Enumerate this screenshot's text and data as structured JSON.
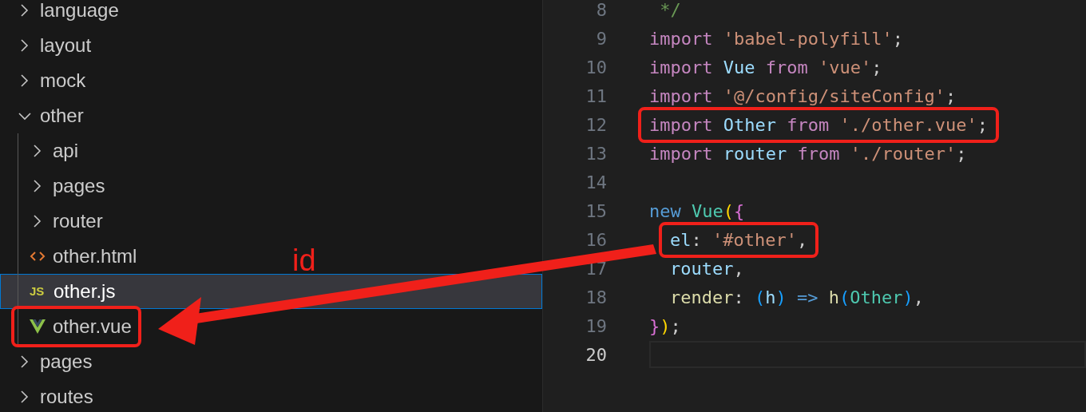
{
  "explorer": {
    "items": [
      {
        "name": "language",
        "kind": "folder",
        "expanded": false,
        "selected": false
      },
      {
        "name": "layout",
        "kind": "folder",
        "expanded": false,
        "selected": false
      },
      {
        "name": "mock",
        "kind": "folder",
        "expanded": false,
        "selected": false
      },
      {
        "name": "other",
        "kind": "folder",
        "expanded": true,
        "selected": false,
        "children": [
          {
            "name": "api",
            "kind": "folder",
            "expanded": false,
            "selected": false
          },
          {
            "name": "pages",
            "kind": "folder",
            "expanded": false,
            "selected": false
          },
          {
            "name": "router",
            "kind": "folder",
            "expanded": false,
            "selected": false
          },
          {
            "name": "other.html",
            "kind": "html",
            "selected": false
          },
          {
            "name": "other.js",
            "kind": "js",
            "badge": "JS",
            "selected": true
          },
          {
            "name": "other.vue",
            "kind": "vue",
            "selected": false,
            "boxed": true
          }
        ]
      },
      {
        "name": "pages",
        "kind": "folder",
        "expanded": false,
        "selected": false
      },
      {
        "name": "routes",
        "kind": "folder",
        "expanded": false,
        "selected": false
      }
    ]
  },
  "editor": {
    "lines": [
      {
        "number": "8",
        "current": false,
        "tokens": [
          {
            "kind": "comment",
            "text": " */"
          }
        ]
      },
      {
        "number": "9",
        "current": false,
        "tokens": [
          {
            "kind": "keyword",
            "text": "import "
          },
          {
            "kind": "string",
            "text": "'babel-polyfill'"
          },
          {
            "kind": "punct",
            "text": ";"
          }
        ]
      },
      {
        "number": "10",
        "current": false,
        "tokens": [
          {
            "kind": "keyword",
            "text": "import "
          },
          {
            "kind": "variable",
            "text": "Vue "
          },
          {
            "kind": "keyword",
            "text": "from "
          },
          {
            "kind": "string",
            "text": "'vue'"
          },
          {
            "kind": "punct",
            "text": ";"
          }
        ]
      },
      {
        "number": "11",
        "current": false,
        "tokens": [
          {
            "kind": "keyword",
            "text": "import "
          },
          {
            "kind": "string",
            "text": "'@/config/siteConfig'"
          },
          {
            "kind": "punct",
            "text": ";"
          }
        ]
      },
      {
        "number": "12",
        "current": false,
        "boxed": true,
        "tokens": [
          {
            "kind": "keyword",
            "text": "import "
          },
          {
            "kind": "variable",
            "text": "Other "
          },
          {
            "kind": "keyword",
            "text": "from "
          },
          {
            "kind": "string",
            "text": "'./other.vue'"
          },
          {
            "kind": "punct",
            "text": ";"
          }
        ]
      },
      {
        "number": "13",
        "current": false,
        "tokens": [
          {
            "kind": "keyword",
            "text": "import "
          },
          {
            "kind": "variable",
            "text": "router "
          },
          {
            "kind": "keyword",
            "text": "from "
          },
          {
            "kind": "string",
            "text": "'./router'"
          },
          {
            "kind": "punct",
            "text": ";"
          }
        ]
      },
      {
        "number": "14",
        "current": false
      },
      {
        "number": "15",
        "current": false,
        "tokens": [
          {
            "kind": "storage",
            "text": "new "
          },
          {
            "kind": "class",
            "text": "Vue"
          },
          {
            "kind": "bracket1",
            "text": "("
          },
          {
            "kind": "bracket2",
            "text": "{"
          }
        ]
      },
      {
        "number": "16",
        "current": false,
        "indented": true,
        "boxed": true,
        "tokens": [
          {
            "kind": "variable",
            "text": "el"
          },
          {
            "kind": "punct",
            "text": ": "
          },
          {
            "kind": "string",
            "text": "'#other'"
          },
          {
            "kind": "punct",
            "text": ","
          }
        ]
      },
      {
        "number": "17",
        "current": false,
        "indented": true,
        "tokens": [
          {
            "kind": "variable",
            "text": "router"
          },
          {
            "kind": "punct",
            "text": ","
          }
        ]
      },
      {
        "number": "18",
        "current": false,
        "indented": true,
        "tokens": [
          {
            "kind": "function",
            "text": "render"
          },
          {
            "kind": "punct",
            "text": ": "
          },
          {
            "kind": "bracket3",
            "text": "("
          },
          {
            "kind": "variable",
            "text": "h"
          },
          {
            "kind": "bracket3",
            "text": ")"
          },
          {
            "kind": "storage",
            "text": " => "
          },
          {
            "kind": "function",
            "text": "h"
          },
          {
            "kind": "bracket3",
            "text": "("
          },
          {
            "kind": "class",
            "text": "Other"
          },
          {
            "kind": "bracket3",
            "text": ")"
          },
          {
            "kind": "punct",
            "text": ","
          }
        ]
      },
      {
        "number": "19",
        "current": false,
        "tokens": [
          {
            "kind": "bracket2",
            "text": "}"
          },
          {
            "kind": "bracket1",
            "text": ")"
          },
          {
            "kind": "punct",
            "text": ";"
          }
        ]
      },
      {
        "number": "20",
        "current": true
      }
    ]
  },
  "annotation": {
    "label": "id"
  }
}
